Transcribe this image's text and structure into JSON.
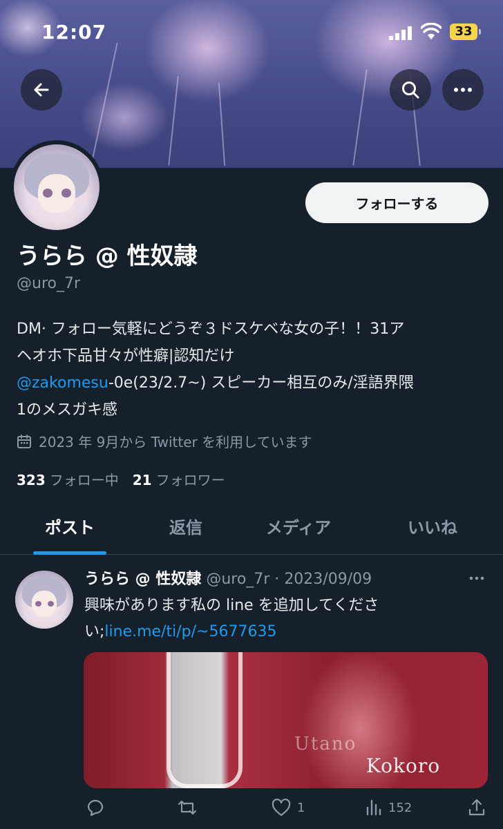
{
  "status_bar": {
    "time": "12:07",
    "battery": "33"
  },
  "profile": {
    "display_name": "うらら @ 性奴隷",
    "handle": "@uro_7r",
    "follow_button": "フォローする",
    "bio_line1": "DM· フォロー気軽にどうぞ３ドスケベな女の子！！31ア",
    "bio_line2": "ヘオホ下品甘々が性癖|認知だけ",
    "bio_mention": "@zakomesu",
    "bio_line3_rest": "-0e(23/2.7~) スピーカー相互のみ/淫語界隈",
    "bio_line4": "1のメスガキ感",
    "joined": "2023 年 9月から Twitter を利用しています",
    "following_count": "323",
    "following_label": "フォロー中",
    "followers_count": "21",
    "followers_label": "フォロワー"
  },
  "tabs": [
    {
      "label": "ポスト",
      "active": true
    },
    {
      "label": "返信",
      "active": false
    },
    {
      "label": "メディア",
      "active": false
    },
    {
      "label": "いいね",
      "active": false
    }
  ],
  "post": {
    "name": "うらら @ 性奴隷",
    "meta": "@uro_7r · 2023/09/09",
    "text_line1": "興味があります私の line を追加してくださ",
    "text_prefix": "い;",
    "link": "line.me/ti/p/~5677635",
    "media_text1": "Utano",
    "media_text2": "Kokoro",
    "likes": "1",
    "views": "152"
  },
  "icons": {
    "back": "arrow-left-icon",
    "search": "search-icon",
    "more": "more-horizontal-icon",
    "calendar": "calendar-icon",
    "reply": "reply-icon",
    "retweet": "retweet-icon",
    "like": "heart-icon",
    "views": "analytics-icon",
    "share": "share-icon"
  },
  "colors": {
    "accent": "#1d9bf0",
    "background": "#15202b",
    "secondary_text": "#8b98a5",
    "battery": "#f7d54a"
  }
}
